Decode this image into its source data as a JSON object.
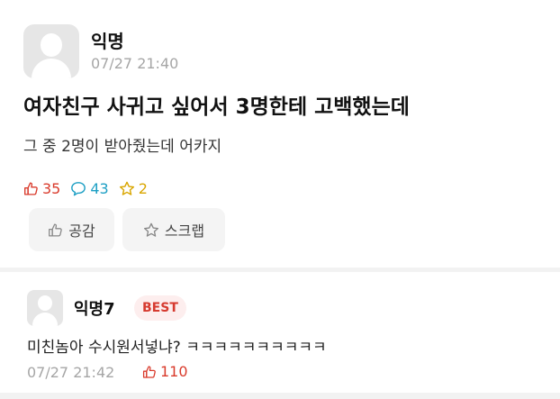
{
  "post": {
    "author": "익명",
    "timestamp": "07/27 21:40",
    "title": "여자친구 사귀고 싶어서 3명한테 고백했는데",
    "content": "그 중 2명이 받아줬는데 어카지",
    "stats": {
      "likes": "35",
      "comments": "43",
      "scraps": "2"
    },
    "buttons": {
      "empathy_label": "공감",
      "scrap_label": "스크랩"
    }
  },
  "comment": {
    "author": "익명7",
    "badge": "BEST",
    "text": "미친놈아 수시원서넣냐? ㅋㅋㅋㅋㅋㅋㅋㅋㅋㅋ",
    "timestamp": "07/27 21:42",
    "likes": "110"
  },
  "colors": {
    "like": "#d93a2b",
    "comment": "#1d9fc4",
    "scrap": "#d9a600",
    "best_badge_bg": "#fdeeee",
    "best_badge_text": "#d63a2f"
  },
  "icons": {
    "like": "thumbs-up-icon",
    "comment": "speech-bubble-icon",
    "scrap": "star-icon"
  }
}
